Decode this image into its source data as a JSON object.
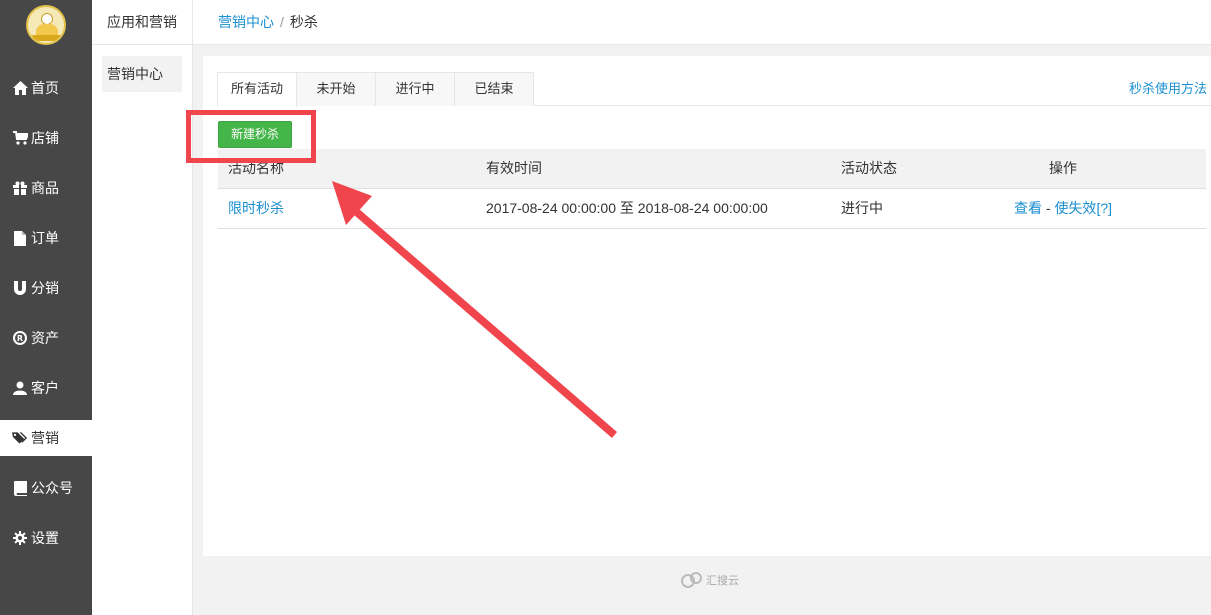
{
  "sidebar": {
    "items": [
      {
        "label": "首页",
        "icon": "home-icon"
      },
      {
        "label": "店铺",
        "icon": "cart-icon"
      },
      {
        "label": "商品",
        "icon": "gift-icon"
      },
      {
        "label": "订单",
        "icon": "file-icon"
      },
      {
        "label": "分销",
        "icon": "magnet-icon"
      },
      {
        "label": "资产",
        "icon": "registered-icon"
      },
      {
        "label": "客户",
        "icon": "user-icon"
      },
      {
        "label": "营销",
        "icon": "tags-icon"
      },
      {
        "label": "公众号",
        "icon": "book-icon"
      },
      {
        "label": "设置",
        "icon": "gear-icon"
      }
    ]
  },
  "subsidebar": {
    "title": "应用和营销",
    "item": "营销中心"
  },
  "breadcrumb": {
    "parent": "营销中心",
    "separator": "/",
    "current": "秒杀"
  },
  "tabs": [
    "所有活动",
    "未开始",
    "进行中",
    "已结束"
  ],
  "help_link": "秒杀使用方法",
  "new_button": "新建秒杀",
  "table": {
    "headers": [
      "活动名称",
      "有效时间",
      "活动状态",
      "操作"
    ],
    "rows": [
      {
        "name": "限时秒杀",
        "time": "2017-08-24 00:00:00 至 2018-08-24 00:00:00",
        "status": "进行中",
        "action_view": "查看",
        "action_sep": "-",
        "action_disable": "使失效",
        "action_help": "[?]"
      }
    ]
  },
  "footer": {
    "brand": "汇搜云"
  },
  "colors": {
    "sidebar_bg": "#474747",
    "link": "#1a8fcf",
    "button_green": "#44b549",
    "annotation_red": "#f0454c"
  }
}
